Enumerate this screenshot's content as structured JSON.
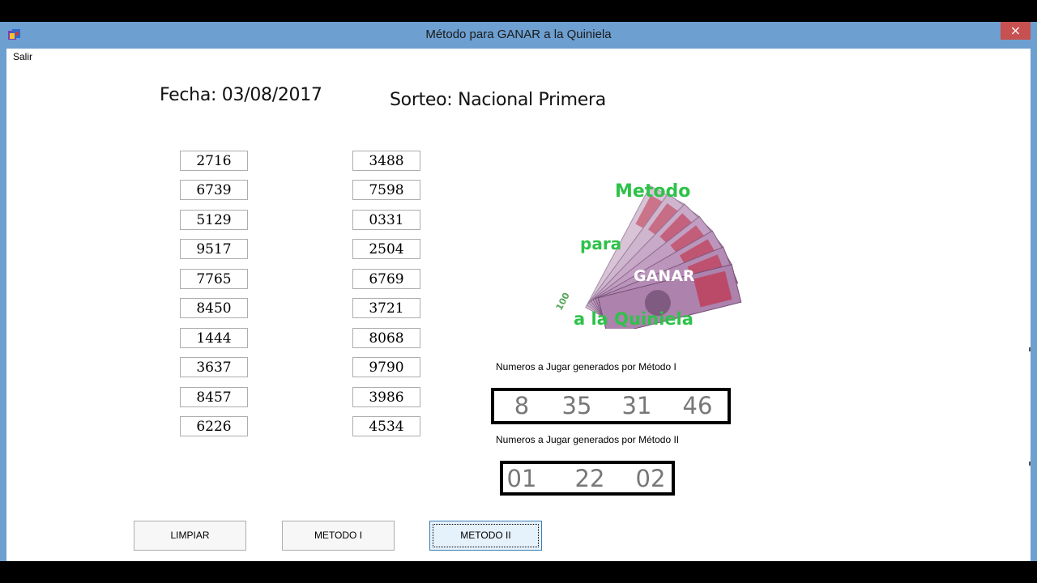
{
  "window": {
    "title": "Método para GANAR a la Quiniela",
    "close_label": "×",
    "menu_salir": "Salir"
  },
  "header": {
    "fecha": "Fecha: 03/08/2017",
    "sorteo": "Sorteo: Nacional Primera"
  },
  "numbers_left": [
    "2716",
    "6739",
    "5129",
    "9517",
    "7765",
    "8450",
    "1444",
    "3637",
    "8457",
    "6226"
  ],
  "numbers_right": [
    "3488",
    "7598",
    "0331",
    "2504",
    "6769",
    "3721",
    "8068",
    "9790",
    "3986",
    "4534"
  ],
  "logo": {
    "line1": "Metodo",
    "line2": "para",
    "line3": "GANAR",
    "line4": "a la Quiniela",
    "note_value": "100",
    "color_text": "#2ec24a"
  },
  "metodo1": {
    "label": "Numeros a Jugar  generados por Método I",
    "values": [
      "8",
      "35",
      "31",
      "46"
    ]
  },
  "metodo2": {
    "label": "Numeros a Jugar  generados por Método II",
    "values": [
      "01",
      "22",
      "02"
    ]
  },
  "buttons": {
    "limpiar": "LIMPIAR",
    "metodo1": "METODO I",
    "metodo2": "METODO II"
  },
  "colors": {
    "title_bar": "#6d9fd0",
    "close_button": "#c75050",
    "result_text": "#777777"
  }
}
